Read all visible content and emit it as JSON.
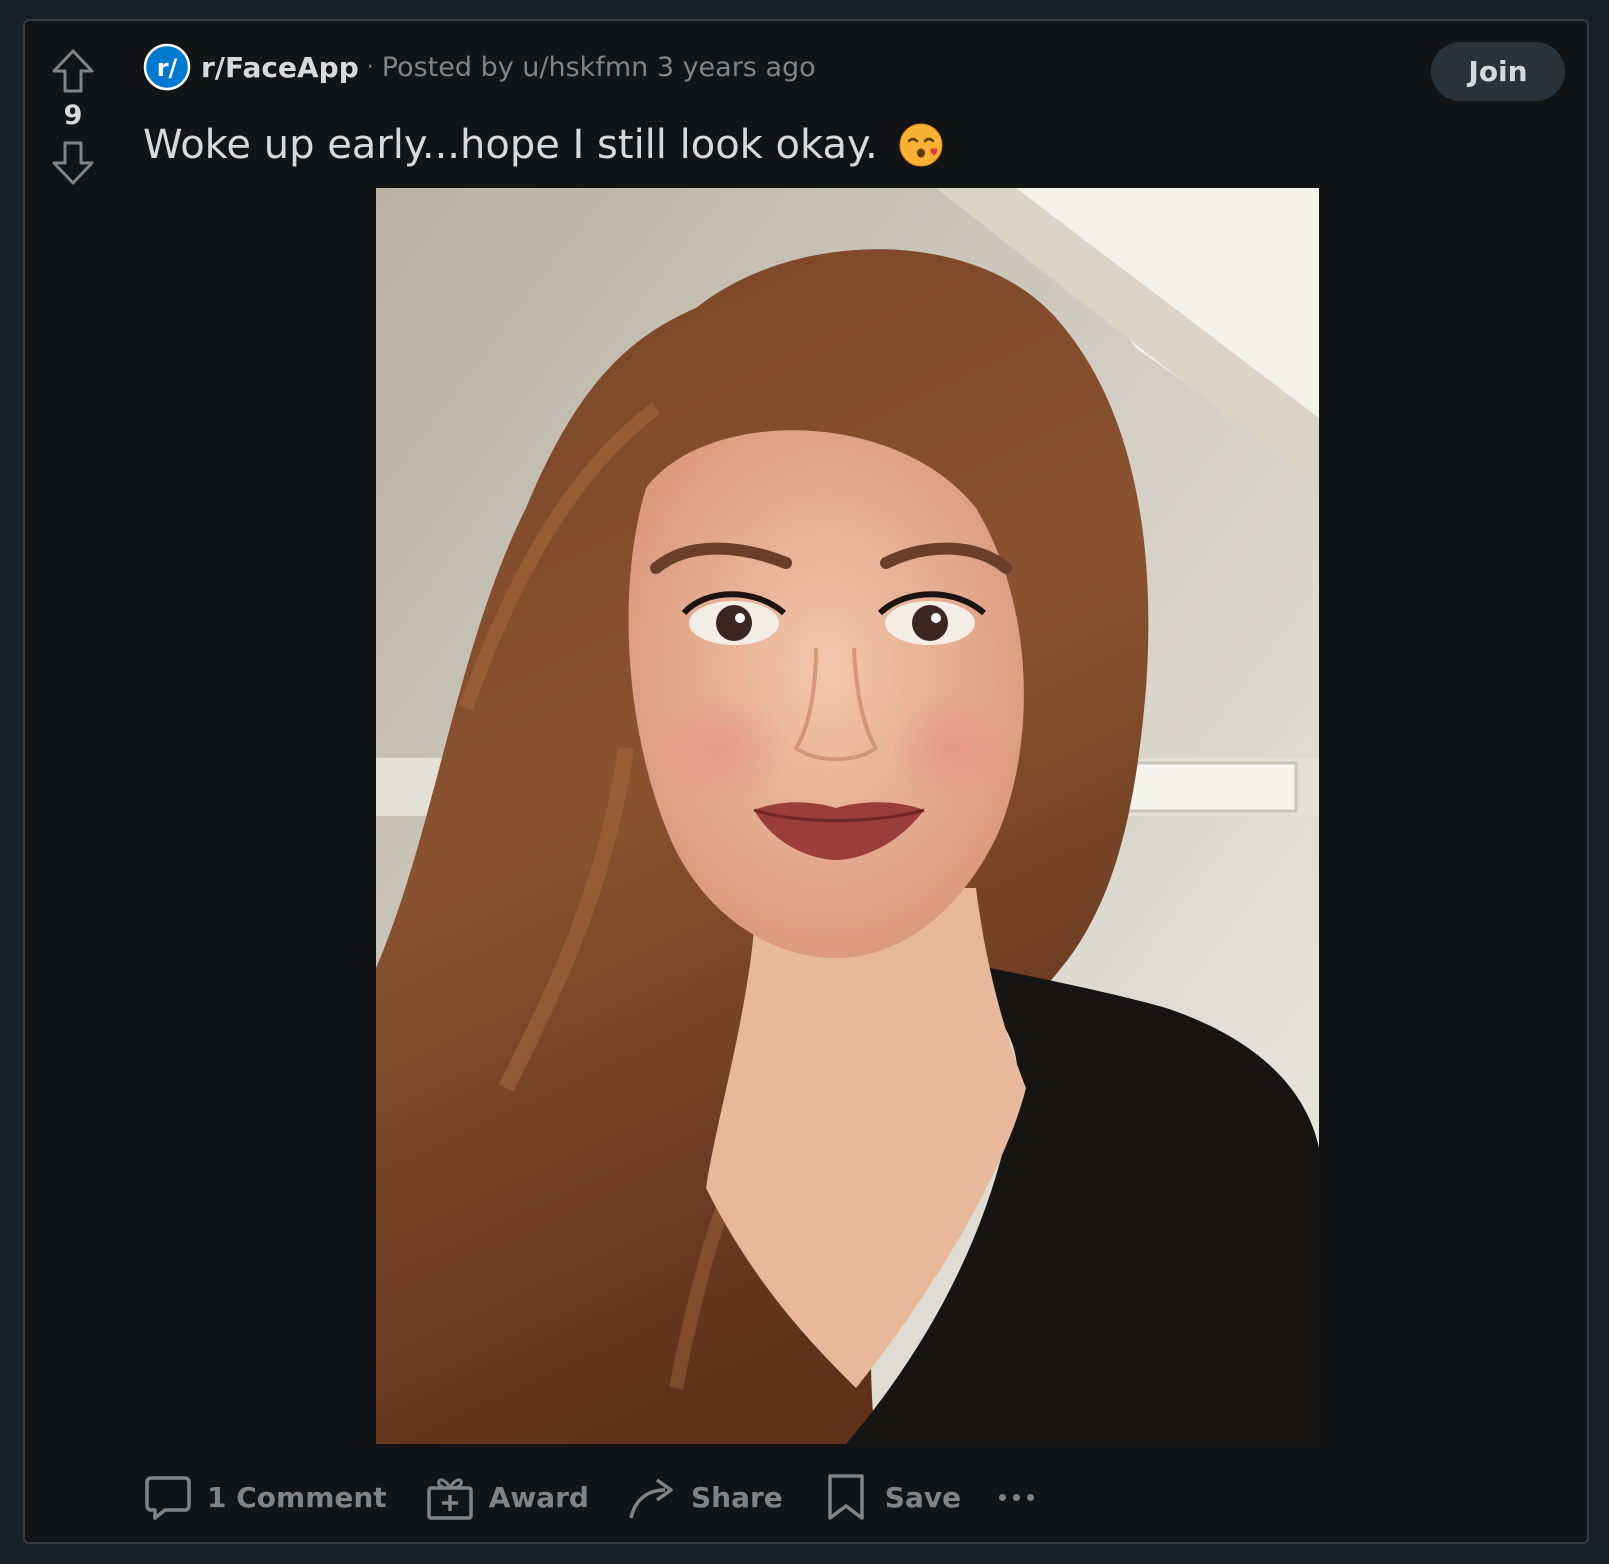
{
  "post": {
    "vote_count": "9",
    "subreddit": "r/FaceApp",
    "separator": "·",
    "posted_by": "Posted by u/hskfmn 3 years ago",
    "title": "Woke up early...hope I still look okay.",
    "emoji": "kissing-face-with-closed-eyes",
    "join_label": "Join"
  },
  "actions": {
    "comments": "1 Comment",
    "award": "Award",
    "share": "Share",
    "save": "Save"
  },
  "colors": {
    "background": "#121415",
    "text": "#d7dadc",
    "muted": "#818384",
    "subreddit_icon": "#0079d3"
  }
}
